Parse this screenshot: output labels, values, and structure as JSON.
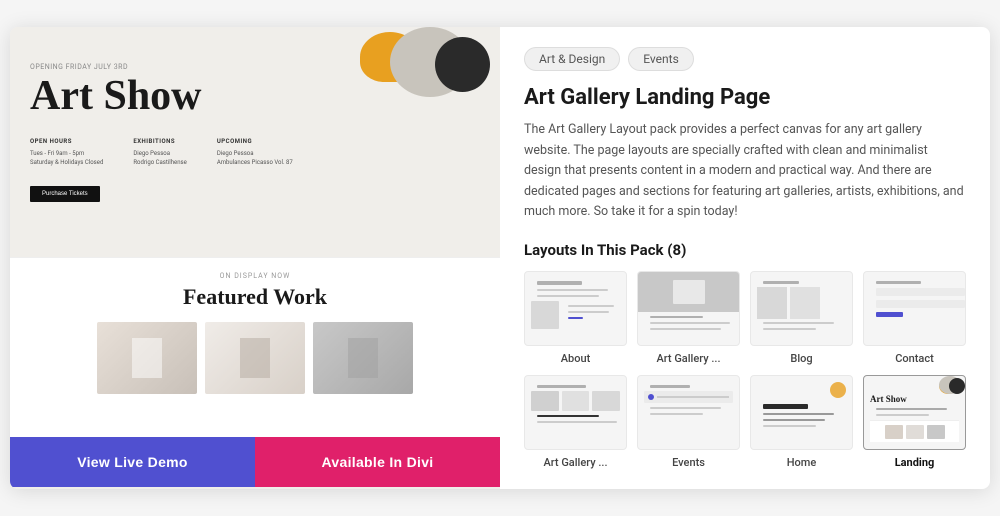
{
  "tags": [
    {
      "label": "Art & Design"
    },
    {
      "label": "Events"
    }
  ],
  "title": "Art Gallery Landing Page",
  "description": "The Art Gallery Layout pack provides a perfect canvas for any art gallery website. The page layouts are specially crafted with clean and minimalist design that presents content in a modern and practical way. And there are dedicated pages and sections for featuring art galleries, artists, exhibitions, and much more. So take it for a spin today!",
  "layouts_heading": "Layouts In This Pack (8)",
  "layouts": [
    {
      "label": "About",
      "type": "about"
    },
    {
      "label": "Art Gallery ...",
      "type": "artgallery"
    },
    {
      "label": "Blog",
      "type": "blog"
    },
    {
      "label": "Contact",
      "type": "contact"
    },
    {
      "label": "Art Gallery ...",
      "type": "artgallery2"
    },
    {
      "label": "Events",
      "type": "events"
    },
    {
      "label": "Home",
      "type": "home"
    },
    {
      "label": "Landing",
      "type": "landing",
      "active": true
    }
  ],
  "buttons": {
    "demo": "View Live Demo",
    "divi": "Available In Divi"
  },
  "preview": {
    "opening": "OPENING FRIDAY JULY 3RD",
    "title": "Art Show",
    "open_hours_label": "OPEN HOURS",
    "open_hours": "Tues - Fri 9am - 5pm\nSaturday & Holidays Closed",
    "exhibitions_label": "EXHIBITIONS",
    "exhibitions": "Diego Pessoa\nRodrigo Castilhense",
    "upcoming_label": "UPCOMING",
    "upcoming": "Diego Pessoa\nAmbulances Picasso Vol. 87",
    "purchase_btn": "Purchase Tickets",
    "on_display": "ON DISPLAY NOW",
    "featured_work": "Featured Work"
  }
}
